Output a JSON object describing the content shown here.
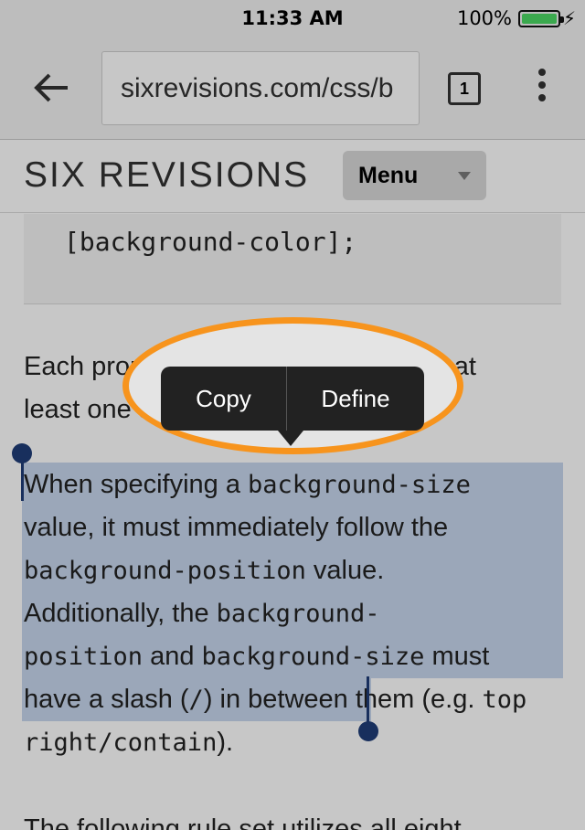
{
  "status_bar": {
    "time": "11:33 AM",
    "battery_percent": "100%",
    "battery_level": 1.0
  },
  "browser": {
    "url": "sixrevisions.com/css/b",
    "tab_count": "1"
  },
  "site": {
    "logo": "SIX REVISIONS",
    "menu_label": "Menu"
  },
  "content": {
    "code_line": "[background-color];",
    "p1_line1": "Each property value is separated by at",
    "p1_line2": "least one space.",
    "p2": {
      "t1": "When specifying a ",
      "c1": "background-size",
      "t2": "value, it must immediately follow the",
      "c2": "background-position",
      "t3": " value.",
      "t4": "Additionally, the ",
      "c3": "background-",
      "c4": "position",
      "t5": " and ",
      "c5": "background-size",
      "t6": " must",
      "t7": "have a slash (",
      "c6": "/",
      "t8": ") in between them (e.g. ",
      "c7": "top",
      "c8": "right/contain",
      "t9": ")."
    },
    "p3": "The following rule set utilizes all eight"
  },
  "context_menu": {
    "copy_label": "Copy",
    "define_label": "Define"
  },
  "colors": {
    "annotation_ring": "#f7941d",
    "selection": "#5082c8",
    "battery": "#4cd964"
  }
}
